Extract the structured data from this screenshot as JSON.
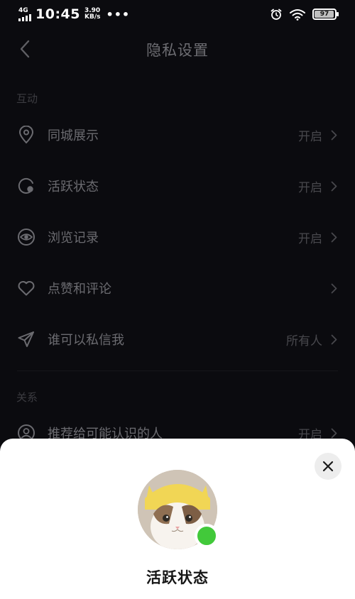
{
  "status_bar": {
    "network": "4G",
    "time": "10:45",
    "speed_value": "3.90",
    "speed_unit": "KB/s",
    "more": "•••",
    "battery": "97"
  },
  "header": {
    "title": "隐私设置"
  },
  "sections": [
    {
      "title": "互动",
      "items": [
        {
          "label": "同城展示",
          "value": "开启",
          "icon": "location-pin-icon"
        },
        {
          "label": "活跃状态",
          "value": "开启",
          "icon": "active-status-icon"
        },
        {
          "label": "浏览记录",
          "value": "开启",
          "icon": "eye-icon"
        },
        {
          "label": "点赞和评论",
          "value": "",
          "icon": "heart-icon"
        },
        {
          "label": "谁可以私信我",
          "value": "所有人",
          "icon": "send-icon"
        }
      ]
    },
    {
      "title": "关系",
      "items": [
        {
          "label": "推荐给可能认识的人",
          "value": "开启",
          "icon": "person-icon"
        }
      ]
    }
  ],
  "sheet": {
    "title": "活跃状态",
    "status_color": "#42c93a"
  },
  "colors": {
    "background": "#0b0b0f",
    "sheet": "#ffffff",
    "online": "#42c93a"
  }
}
